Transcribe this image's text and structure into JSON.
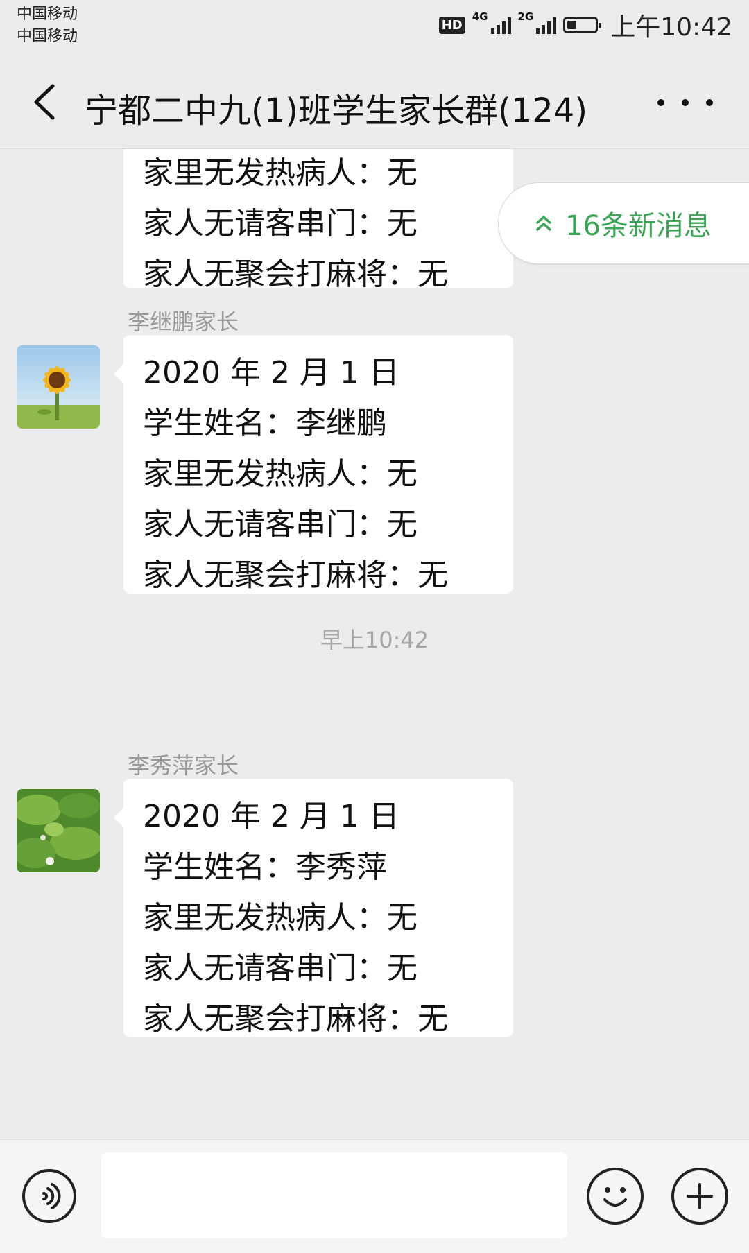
{
  "status_bar": {
    "carrier_1": "中国移动",
    "carrier_2": "中国移动",
    "hd": "HD",
    "network_1": "4G",
    "network_2": "2G",
    "battery_level": 0.35,
    "time": "上午10:42"
  },
  "header": {
    "title": "宁都二中九(1)班学生家长群(124)",
    "back_icon": "chevron-left-icon",
    "more_icon": "more-horizontal-icon"
  },
  "new_messages": {
    "label": "16条新消息",
    "icon": "double-chevron-up-icon",
    "color": "#3aa655"
  },
  "messages": [
    {
      "sender": "",
      "lines": [
        "家里无发热病人：无",
        "家人无请客串门：无",
        "家人无聚会打麻将：无"
      ]
    },
    {
      "sender": "李继鹏家长",
      "avatar": "sunflower-avatar",
      "lines": [
        "2020 年 2 月 1 日",
        "学生姓名：李继鹏",
        "家里无发热病人：无",
        "家人无请客串门：无",
        "家人无聚会打麻将：无"
      ]
    },
    {
      "sender": "李秀萍家长",
      "avatar": "lotus-leaf-avatar",
      "lines": [
        "2020 年 2 月 1 日",
        "学生姓名：李秀萍",
        "家里无发热病人：无",
        "家人无请客串门：无",
        "家人无聚会打麻将：无"
      ]
    }
  ],
  "time_separator": "早上10:42",
  "input_bar": {
    "voice_icon": "voice-icon",
    "input_value": "",
    "emoji_icon": "emoji-icon",
    "plus_icon": "plus-icon"
  },
  "colors": {
    "background": "#ececec",
    "bubble": "#ffffff",
    "accent_green": "#3aa655"
  }
}
